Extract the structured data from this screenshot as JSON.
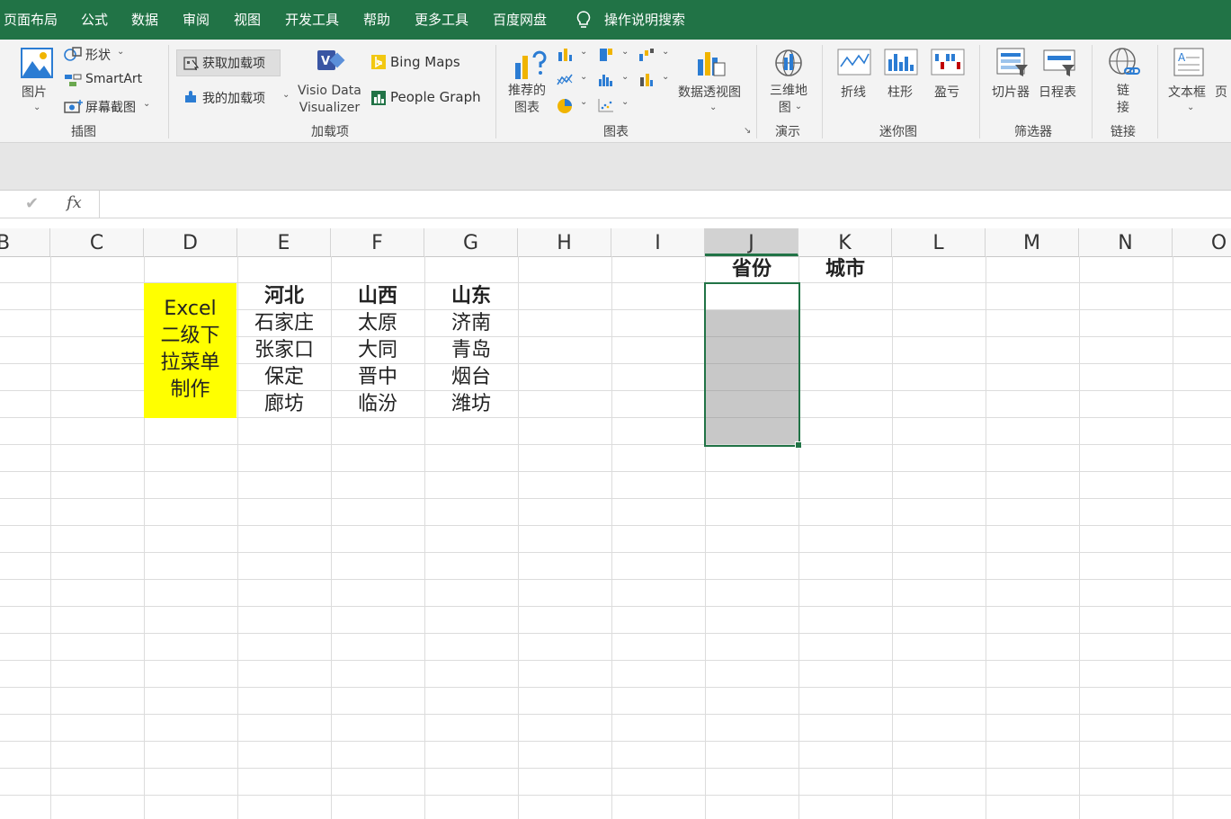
{
  "menu": {
    "tabs": [
      "页面布局",
      "公式",
      "数据",
      "审阅",
      "视图",
      "开发工具",
      "帮助",
      "更多工具",
      "百度网盘"
    ],
    "search_label": "操作说明搜索"
  },
  "ribbon": {
    "illustrations": {
      "picture": "图片",
      "shapes": "形状",
      "smartart": "SmartArt",
      "screenshot": "屏幕截图",
      "group": "插图"
    },
    "addins": {
      "get_addins": "获取加载项",
      "my_addins": "我的加载项",
      "visio_line1": "Visio Data",
      "visio_line2": "Visualizer",
      "bing_maps": "Bing Maps",
      "people_graph": "People Graph",
      "group": "加载项"
    },
    "charts": {
      "recommended_line1": "推荐的",
      "recommended_line2": "图表",
      "pivot_chart": "数据透视图",
      "group": "图表"
    },
    "tours": {
      "map3d_line1": "三维地",
      "map3d_line2": "图",
      "group": "演示"
    },
    "sparklines": {
      "line": "折线",
      "column": "柱形",
      "winloss": "盈亏",
      "group": "迷你图"
    },
    "filters": {
      "slicer": "切片器",
      "timeline": "日程表",
      "group": "筛选器"
    },
    "links": {
      "link_line1": "链",
      "link_line2": "接",
      "group": "链接"
    },
    "text": {
      "textbox": "文本框",
      "partial": "页"
    }
  },
  "formula_bar": {
    "fx": "fx",
    "value": ""
  },
  "columns": [
    "B",
    "C",
    "D",
    "E",
    "F",
    "G",
    "H",
    "I",
    "J",
    "K",
    "L",
    "M",
    "N",
    "O"
  ],
  "selected_column": "J",
  "sheet": {
    "title_lines": [
      "Excel",
      "二级下",
      "拉菜单",
      "制作"
    ],
    "title_bg": "#ffff00",
    "provinces": [
      "河北",
      "山西",
      "山东"
    ],
    "cities": [
      [
        "石家庄",
        "太原",
        "济南"
      ],
      [
        "张家口",
        "大同",
        "青岛"
      ],
      [
        "保定",
        "晋中",
        "烟台"
      ],
      [
        "廊坊",
        "临汾",
        "潍坊"
      ]
    ],
    "header_province": "省份",
    "header_city": "城市"
  },
  "colors": {
    "menubar": "#217346",
    "selection": "#217346",
    "selected_fill": "#c8c8c8"
  }
}
